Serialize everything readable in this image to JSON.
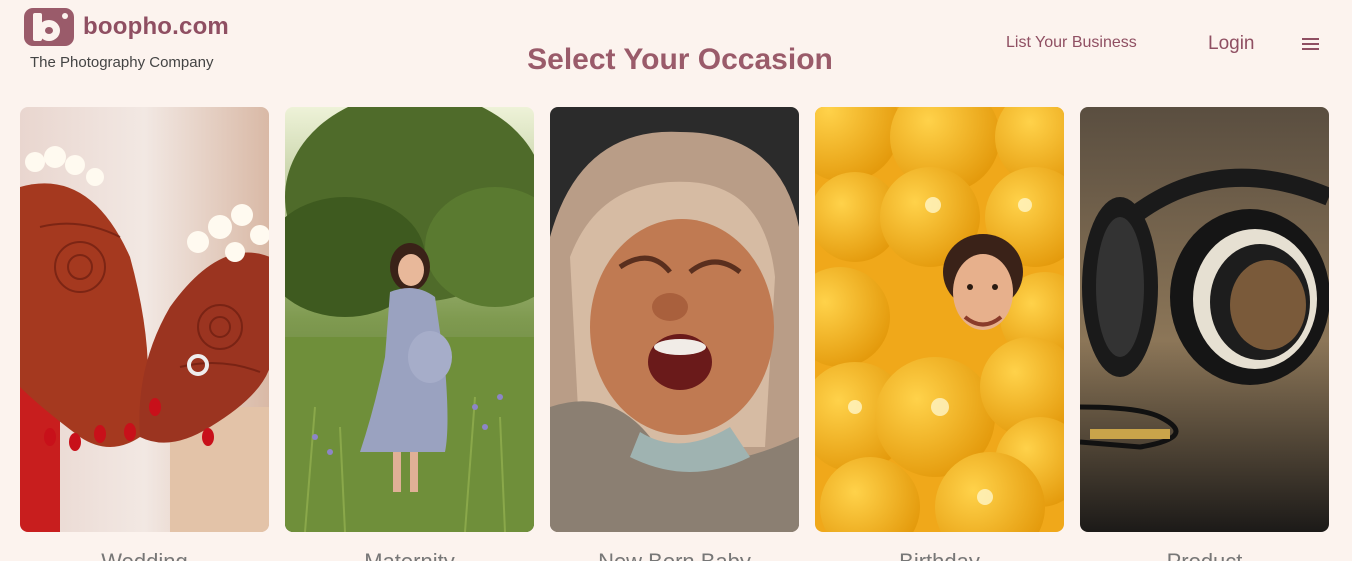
{
  "header": {
    "brand": "boopho.com",
    "tagline": "The Photography Company",
    "title": "Select Your Occasion",
    "nav": {
      "list_business": "List Your Business",
      "login": "Login"
    }
  },
  "occasions": [
    {
      "label": "Wedding",
      "icon": "wedding-image"
    },
    {
      "label": "Maternity",
      "icon": "maternity-image"
    },
    {
      "label": "New Born Baby",
      "icon": "newborn-image"
    },
    {
      "label": "Birthday",
      "icon": "birthday-image"
    },
    {
      "label": "Product",
      "icon": "product-image"
    }
  ],
  "colors": {
    "brand": "#9a5b6a",
    "background": "#fcf3ee"
  }
}
